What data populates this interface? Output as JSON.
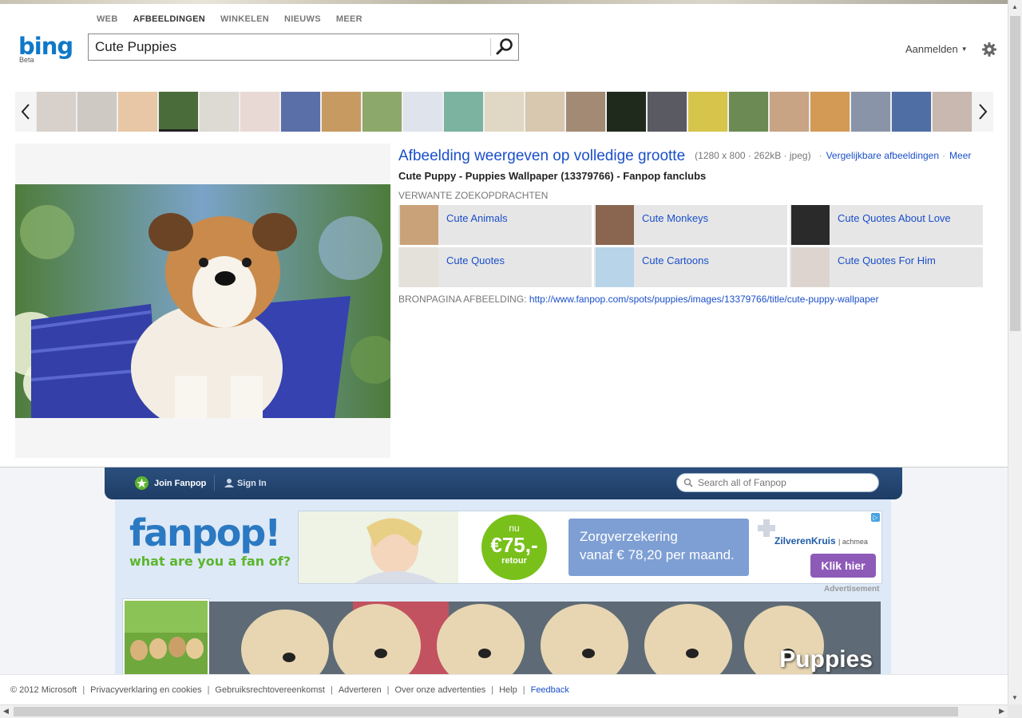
{
  "scopes": [
    "WEB",
    "AFBEELDINGEN",
    "WINKELEN",
    "NIEUWS",
    "MEER"
  ],
  "active_scope": "AFBEELDINGEN",
  "logo": {
    "text": "bing",
    "beta": "Beta"
  },
  "search": {
    "value": "Cute Puppies"
  },
  "signin": "Aanmelden",
  "filmstrip": {
    "thumb_colors": [
      "#d8d0cb",
      "#cfc9c4",
      "#e7c7a6",
      "#4a6c3a",
      "#dcdad2",
      "#e9d9d5",
      "#5a6ea8",
      "#c79a62",
      "#8ca86a",
      "#dfe3ec",
      "#7cb2a0",
      "#e0d8c4",
      "#d8c8b0",
      "#a38a74",
      "#1f2a1c",
      "#5a5a62",
      "#d7c44a",
      "#6c8a54",
      "#c8a484",
      "#d39a55",
      "#8a94a8",
      "#4f6ea4",
      "#c8b8b0"
    ],
    "selected_index": 3
  },
  "info": {
    "full_size_link": "Afbeelding weergeven op volledige grootte",
    "meta": "(1280 x 800 · 262kB · jpeg)",
    "similar_link": "Vergelijkbare afbeeldingen",
    "more_link": "Meer",
    "page_title": "Cute Puppy - Puppies Wallpaper (13379766) - Fanpop fanclubs",
    "related_heading": "VERWANTE ZOEKOPDRACHTEN",
    "related": [
      {
        "label": "Cute Animals",
        "color": "#c9a27a"
      },
      {
        "label": "Cute Monkeys",
        "color": "#8a6650"
      },
      {
        "label": "Cute Quotes About Love",
        "color": "#2a2a2a"
      },
      {
        "label": "Cute Quotes",
        "color": "#e4e0da"
      },
      {
        "label": "Cute Cartoons",
        "color": "#b8d4e8"
      },
      {
        "label": "Cute Quotes For Him",
        "color": "#ddd4d0"
      }
    ],
    "source_label": "BRONPAGINA AFBEELDING:",
    "source_url": "http://www.fanpop.com/spots/puppies/images/13379766/title/cute-puppy-wallpaper"
  },
  "fanpop": {
    "join": "Join Fanpop",
    "signin": "Sign In",
    "search_placeholder": "Search all of Fanpop",
    "logo": "fanpop!",
    "tagline": "what are you a fan of?",
    "ad": {
      "nu": "nu",
      "amount": "€75,-",
      "retour": "retour",
      "line1": "Zorgverzekering",
      "line2": "vanaf € 78,20 per maand.",
      "brand": "ZilverenKruis",
      "brand_sub": "| achmea",
      "cta": "Klik hier"
    },
    "ad_label": "Advertisement",
    "banner_word": "Puppies"
  },
  "footer": {
    "items": [
      "© 2012 Microsoft",
      "Privacyverklaring en cookies",
      "Gebruiksrechtovereenkomst",
      "Adverteren",
      "Over onze advertenties",
      "Help"
    ],
    "feedback": "Feedback"
  }
}
